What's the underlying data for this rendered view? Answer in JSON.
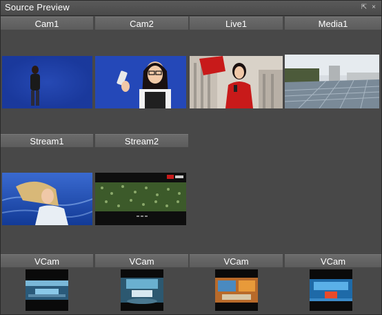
{
  "window": {
    "title": "Source Preview",
    "pin_icon": "pin-icon",
    "close_icon": "close-icon"
  },
  "sources": {
    "row1": [
      "Cam1",
      "Cam2",
      "Live1",
      "Media1"
    ],
    "row2": [
      "Stream1",
      "Stream2"
    ],
    "row3": [
      "VCam",
      "VCam",
      "VCam",
      "VCam"
    ]
  },
  "colors": {
    "panel": "#484848",
    "label_bg": "#656565",
    "chroma_blue": "#1e3fa8"
  }
}
